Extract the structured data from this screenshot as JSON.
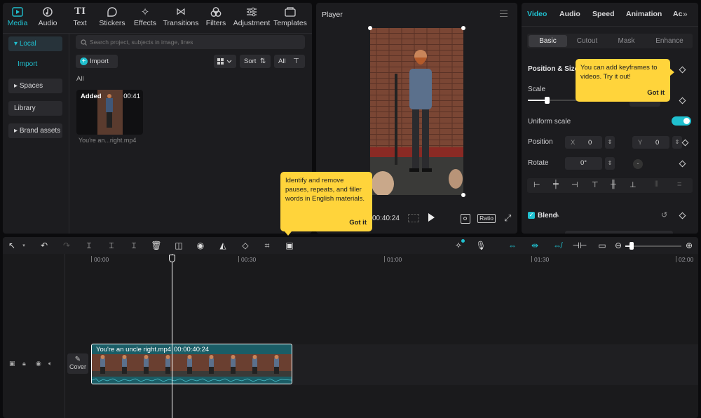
{
  "media_tabs": [
    {
      "label": "Media",
      "icon": "media-icon",
      "active": true
    },
    {
      "label": "Audio",
      "icon": "audio-icon"
    },
    {
      "label": "Text",
      "icon": "text-icon"
    },
    {
      "label": "Stickers",
      "icon": "stickers-icon"
    },
    {
      "label": "Effects",
      "icon": "effects-icon"
    },
    {
      "label": "Transitions",
      "icon": "transitions-icon"
    },
    {
      "label": "Filters",
      "icon": "filters-icon"
    },
    {
      "label": "Adjustment",
      "icon": "adjustment-icon"
    },
    {
      "label": "Templates",
      "icon": "templates-icon"
    }
  ],
  "sidebar": {
    "local": "Local",
    "import": "Import",
    "spaces": "Spaces",
    "library": "Library",
    "brand_assets": "Brand assets"
  },
  "search": {
    "placeholder": "Search project, subjects in image, lines"
  },
  "toolbar": {
    "import": "Import",
    "sort": "Sort",
    "all": "All"
  },
  "media": {
    "section": "All",
    "clip_badge": "Added",
    "clip_duration": "00:41",
    "clip_name": "You're an...right.mp4"
  },
  "player": {
    "title": "Player",
    "timecode": "00:40:24",
    "ratio": "Ratio"
  },
  "inspector": {
    "tabs": [
      "Video",
      "Audio",
      "Speed",
      "Animation",
      "Ac"
    ],
    "subtabs": [
      "Basic",
      "Cutout",
      "Mask",
      "Enhance"
    ],
    "pos_size": "Position & Size",
    "scale": "Scale",
    "scale_value": "100%",
    "scale_level": 0.2,
    "uniform_scale": "Uniform scale",
    "position": "Position",
    "x_label": "X",
    "x_value": "0",
    "y_label": "Y",
    "y_value": "0",
    "rotate": "Rotate",
    "rotate_value": "0°",
    "blend": "Blend"
  },
  "tips": {
    "keyframe_text": "You can add keyframes to videos. Try it out!",
    "keyframe_button": "Got it",
    "filler_text": "Identify and remove pauses, repeats, and filler words in English materials.",
    "filler_button": "Got it"
  },
  "timeline": {
    "ruler": [
      "00:00",
      "00:30",
      "01:00",
      "01:30",
      "02:00"
    ],
    "clip_label": "You're an uncle right.mp4",
    "clip_time": "00:00:40:24",
    "cover": "Cover"
  },
  "colors": {
    "accent": "#20c0cf",
    "tooltip": "#ffd43b",
    "clip": "#1f6e78"
  }
}
